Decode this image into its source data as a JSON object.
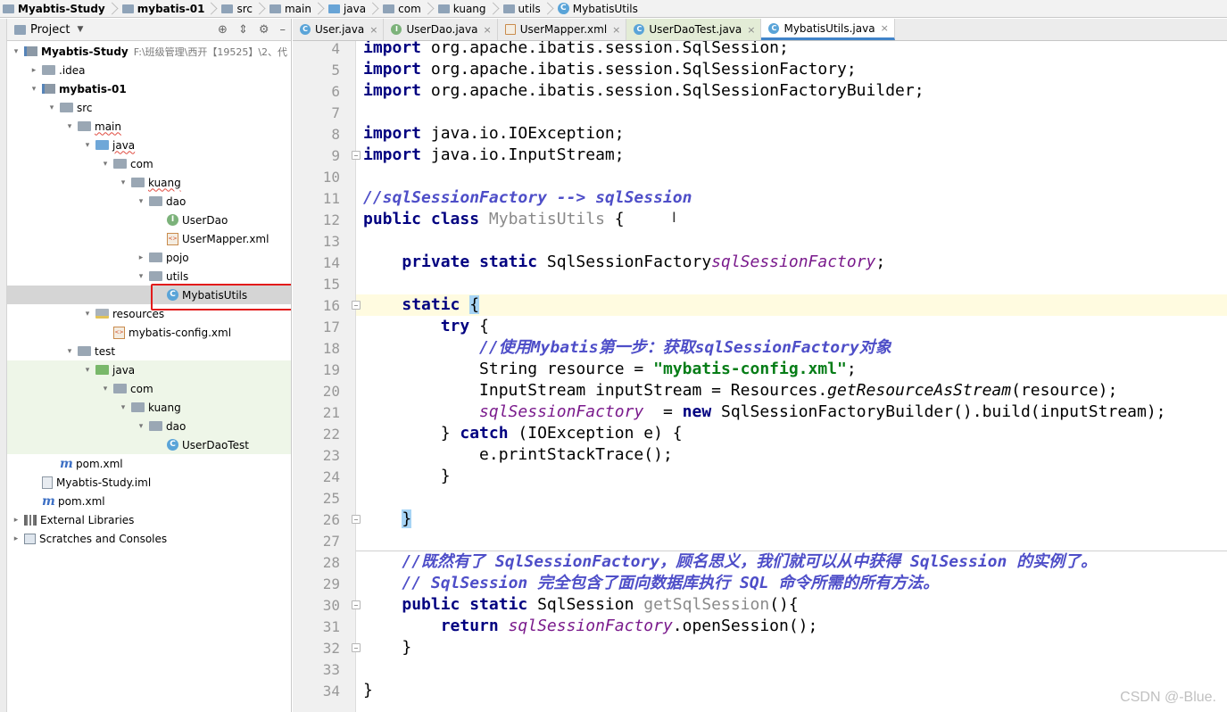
{
  "breadcrumb": [
    "Myabtis-Study",
    "mybatis-01",
    "src",
    "main",
    "java",
    "com",
    "kuang",
    "utils",
    "MybatisUtils"
  ],
  "project_panel": {
    "title": "Project",
    "tree": [
      {
        "label": "Myabtis-Study",
        "path": "F:\\班级管理\\西开【19525】\\2、代",
        "bold": true,
        "icon": "module-icon",
        "arrow": "▾"
      },
      {
        "label": ".idea",
        "icon": "folder-icon",
        "arrow": "▸"
      },
      {
        "label": "mybatis-01",
        "bold": true,
        "icon": "module-icon",
        "arrow": "▾"
      },
      {
        "label": "src",
        "icon": "folder-icon",
        "arrow": "▾"
      },
      {
        "label": "main",
        "icon": "folder-icon",
        "arrow": "▾",
        "wavy": true
      },
      {
        "label": "java",
        "icon": "source-folder-icon",
        "arrow": "▾",
        "wavy": true
      },
      {
        "label": "com",
        "icon": "package-icon",
        "arrow": "▾"
      },
      {
        "label": "kuang",
        "icon": "package-icon",
        "arrow": "▾",
        "wavy": true
      },
      {
        "label": "dao",
        "icon": "package-icon",
        "arrow": "▾"
      },
      {
        "label": "UserDao",
        "icon": "interface-icon",
        "arrow": ""
      },
      {
        "label": "UserMapper.xml",
        "icon": "xml-file-icon",
        "arrow": ""
      },
      {
        "label": "pojo",
        "icon": "package-icon",
        "arrow": "▸"
      },
      {
        "label": "utils",
        "icon": "package-icon",
        "arrow": "▾"
      },
      {
        "label": "MybatisUtils",
        "icon": "class-icon",
        "arrow": "",
        "selected": true
      },
      {
        "label": "resources",
        "icon": "resources-folder-icon",
        "arrow": "▾"
      },
      {
        "label": "mybatis-config.xml",
        "icon": "xml-file-icon",
        "arrow": ""
      },
      {
        "label": "test",
        "icon": "folder-icon",
        "arrow": "▾"
      },
      {
        "label": "java",
        "icon": "test-folder-icon",
        "arrow": "▾",
        "test": true
      },
      {
        "label": "com",
        "icon": "package-icon",
        "arrow": "▾",
        "test": true
      },
      {
        "label": "kuang",
        "icon": "package-icon",
        "arrow": "▾",
        "test": true
      },
      {
        "label": "dao",
        "icon": "package-icon",
        "arrow": "▾",
        "test": true
      },
      {
        "label": "UserDaoTest",
        "icon": "class-icon",
        "arrow": "",
        "test": true
      },
      {
        "label": "pom.xml",
        "icon": "maven-icon",
        "arrow": ""
      },
      {
        "label": "Myabtis-Study.iml",
        "icon": "iml-file-icon",
        "arrow": ""
      },
      {
        "label": "pom.xml",
        "icon": "maven-icon",
        "arrow": ""
      },
      {
        "label": "External Libraries",
        "icon": "library-icon",
        "arrow": "▸"
      },
      {
        "label": "Scratches and Consoles",
        "icon": "scratches-icon",
        "arrow": "▸"
      }
    ]
  },
  "tabs": [
    {
      "label": "User.java",
      "icon": "class-icon"
    },
    {
      "label": "UserDao.java",
      "icon": "interface-icon"
    },
    {
      "label": "UserMapper.xml",
      "icon": "xml-file-icon"
    },
    {
      "label": "UserDaoTest.java",
      "icon": "class-icon",
      "tested": true
    },
    {
      "label": "MybatisUtils.java",
      "icon": "class-icon",
      "active": true
    }
  ],
  "editor": {
    "line_numbers": [
      "4",
      "5",
      "6",
      "7",
      "8",
      "9",
      "10",
      "11",
      "12",
      "13",
      "14",
      "15",
      "16",
      "17",
      "18",
      "19",
      "20",
      "21",
      "22",
      "23",
      "24",
      "25",
      "26",
      "27",
      "28",
      "29",
      "30",
      "31",
      "32",
      "33",
      "34"
    ],
    "code": [
      {
        "ln": "4",
        "t": [
          [
            "kw",
            "import"
          ],
          [
            "",
            "org.apache.ibatis.session.SqlSession;"
          ]
        ]
      },
      {
        "ln": "5",
        "t": [
          [
            "kw",
            "import"
          ],
          [
            "",
            "org.apache.ibatis.session.SqlSessionFactory;"
          ]
        ]
      },
      {
        "ln": "6",
        "t": [
          [
            "kw",
            "import"
          ],
          [
            "",
            "org.apache.ibatis.session.SqlSessionFactoryBuilder;"
          ]
        ]
      },
      {
        "ln": "7",
        "t": []
      },
      {
        "ln": "8",
        "t": [
          [
            "kw",
            "import"
          ],
          [
            "",
            "java.io.IOException;"
          ]
        ]
      },
      {
        "ln": "9",
        "t": [
          [
            "kw",
            "import"
          ],
          [
            "",
            "java.io.InputStream;"
          ]
        ]
      },
      {
        "ln": "10",
        "t": []
      },
      {
        "ln": "11",
        "t": [
          [
            "cmb",
            "//sqlSessionFactory --> sqlSession"
          ]
        ]
      },
      {
        "ln": "12",
        "t": [
          [
            "kw",
            "public"
          ],
          [
            "kw",
            "class"
          ],
          [
            "gray",
            "MybatisUtils"
          ],
          [
            "",
            "{"
          ]
        ]
      },
      {
        "ln": "13",
        "t": []
      },
      {
        "ln": "14",
        "t": [
          [
            "",
            "    "
          ],
          [
            "kw",
            "private"
          ],
          [
            "kw",
            "static"
          ],
          [
            "",
            "SqlSessionFactory"
          ],
          [
            "fld",
            "sqlSessionFactory"
          ],
          [
            "",
            ";"
          ]
        ]
      },
      {
        "ln": "15",
        "t": []
      },
      {
        "ln": "16",
        "t": [
          [
            "",
            "    "
          ],
          [
            "kw",
            "static"
          ],
          [
            "brace",
            "{"
          ]
        ]
      },
      {
        "ln": "17",
        "t": [
          [
            "",
            "        "
          ],
          [
            "kw",
            "try"
          ],
          [
            "",
            "{"
          ]
        ]
      },
      {
        "ln": "18",
        "t": [
          [
            "",
            "            "
          ],
          [
            "cmb",
            "//使用Mybatis第一步：获取sqlSessionFactory对象"
          ]
        ]
      },
      {
        "ln": "19",
        "t": [
          [
            "",
            "            String resource = "
          ],
          [
            "st",
            "\"mybatis-config.xml\""
          ],
          [
            "",
            ";"
          ]
        ]
      },
      {
        "ln": "20",
        "t": [
          [
            "",
            "            InputStream inputStream = Resources."
          ],
          [
            "mth",
            "getResourceAsStream"
          ],
          [
            "",
            "(resource);"
          ]
        ]
      },
      {
        "ln": "21",
        "t": [
          [
            "",
            "            "
          ],
          [
            "fld",
            "sqlSessionFactory"
          ],
          [
            "",
            ""
          ],
          [
            "",
            "="
          ],
          [
            "kw",
            "new"
          ],
          [
            "",
            "SqlSessionFactoryBuilder().build(inputStream);"
          ]
        ]
      },
      {
        "ln": "22",
        "t": [
          [
            "",
            "        } "
          ],
          [
            "kw",
            "catch"
          ],
          [
            "",
            "(IOException e) {"
          ]
        ]
      },
      {
        "ln": "23",
        "t": [
          [
            "",
            "            e.printStackTrace();"
          ]
        ]
      },
      {
        "ln": "24",
        "t": [
          [
            "",
            "        }"
          ]
        ]
      },
      {
        "ln": "25",
        "t": []
      },
      {
        "ln": "26",
        "t": [
          [
            "",
            "    "
          ],
          [
            "brace",
            "}"
          ]
        ]
      },
      {
        "ln": "27",
        "t": []
      },
      {
        "ln": "28",
        "t": [
          [
            "",
            "    "
          ],
          [
            "cmb",
            "//既然有了 SqlSessionFactory，顾名思义，我们就可以从中获得 SqlSession 的实例了。"
          ]
        ]
      },
      {
        "ln": "29",
        "t": [
          [
            "",
            "    "
          ],
          [
            "cmb",
            "// SqlSession 完全包含了面向数据库执行 SQL 命令所需的所有方法。"
          ]
        ]
      },
      {
        "ln": "30",
        "t": [
          [
            "",
            "    "
          ],
          [
            "kw",
            "public"
          ],
          [
            "kw",
            "static"
          ],
          [
            "",
            "SqlSession "
          ],
          [
            "gray",
            "getSqlSession"
          ],
          [
            "",
            "(){"
          ]
        ]
      },
      {
        "ln": "31",
        "t": [
          [
            "",
            "        "
          ],
          [
            "kw",
            "return"
          ],
          [
            "fld",
            "sqlSessionFactory"
          ],
          [
            "",
            ".openSession();"
          ]
        ]
      },
      {
        "ln": "32",
        "t": [
          [
            "",
            "    }"
          ]
        ]
      },
      {
        "ln": "33",
        "t": []
      },
      {
        "ln": "34",
        "t": [
          [
            "",
            "}"
          ]
        ]
      }
    ]
  },
  "watermark": "CSDN @-Blue."
}
